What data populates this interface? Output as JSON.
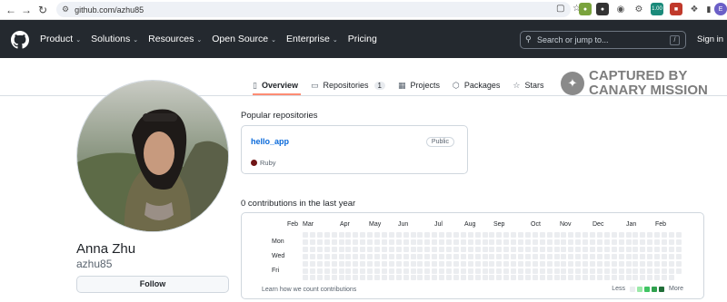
{
  "browser": {
    "url": "github.com/azhu85",
    "extension_badge": "1.00"
  },
  "header": {
    "menu": [
      {
        "label": "Product",
        "caret": true
      },
      {
        "label": "Solutions",
        "caret": true
      },
      {
        "label": "Resources",
        "caret": true
      },
      {
        "label": "Open Source",
        "caret": true
      },
      {
        "label": "Enterprise",
        "caret": true
      },
      {
        "label": "Pricing",
        "caret": false
      }
    ],
    "search_placeholder": "Search or jump to...",
    "search_shortcut": "/",
    "signin": "Sign in"
  },
  "tabs": [
    {
      "label": "Overview",
      "icon": "book-icon",
      "glyph": "▯",
      "active": true,
      "count": ""
    },
    {
      "label": "Repositories",
      "icon": "repo-icon",
      "glyph": "▭",
      "active": false,
      "count": "1"
    },
    {
      "label": "Projects",
      "icon": "table-icon",
      "glyph": "▦",
      "active": false,
      "count": ""
    },
    {
      "label": "Packages",
      "icon": "package-icon",
      "glyph": "⬡",
      "active": false,
      "count": ""
    },
    {
      "label": "Stars",
      "icon": "star-icon",
      "glyph": "☆",
      "active": false,
      "count": ""
    }
  ],
  "watermark": {
    "line1": "CAPTURED BY",
    "line2": "CANARY MISSION"
  },
  "profile": {
    "name": "Anna Zhu",
    "login": "azhu85",
    "follow_label": "Follow"
  },
  "popular": {
    "title": "Popular repositories",
    "repos": [
      {
        "name": "hello_app",
        "visibility": "Public",
        "language": "Ruby",
        "language_color": "#701516"
      }
    ]
  },
  "contributions": {
    "title": "0 contributions in the last year",
    "months": [
      "Feb",
      "Mar",
      "Apr",
      "May",
      "Jun",
      "Jul",
      "Aug",
      "Sep",
      "Oct",
      "Nov",
      "Dec",
      "Jan",
      "Feb"
    ],
    "days": [
      "Mon",
      "Wed",
      "Fri"
    ],
    "learn_link": "Learn how we count contributions",
    "legend_less": "Less",
    "legend_more": "More",
    "legend_colors": [
      "#ebedf0",
      "#9be9a8",
      "#40c463",
      "#30a14e",
      "#216e39"
    ]
  },
  "colors": {
    "header_bg": "#24292f",
    "accent": "#fd8c73",
    "link": "#0969da"
  }
}
